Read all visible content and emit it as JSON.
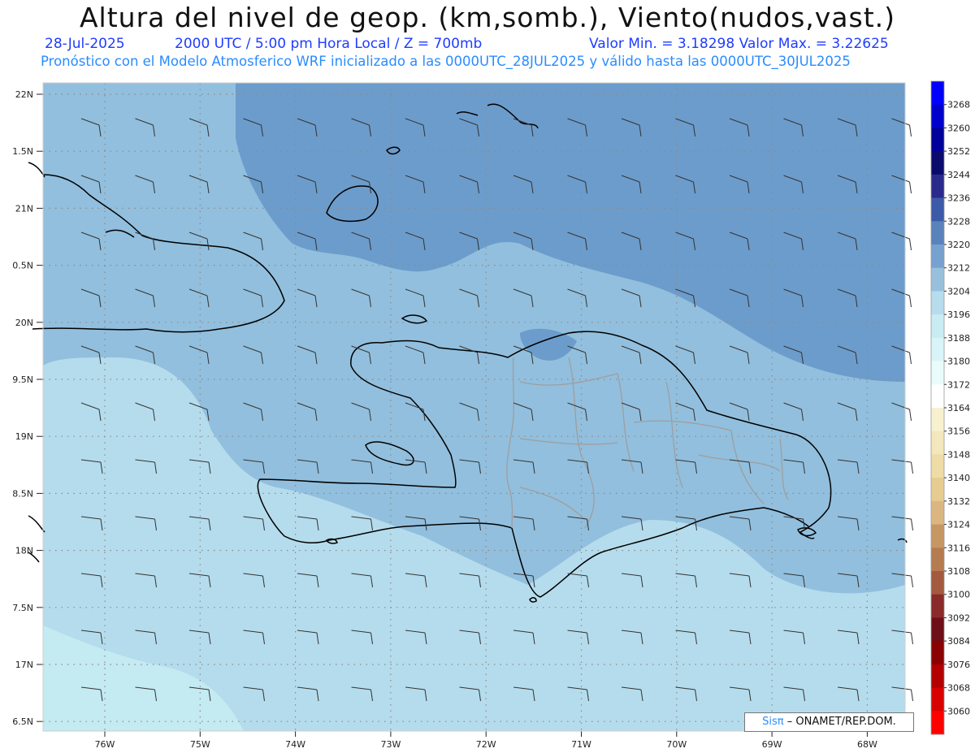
{
  "header": {
    "title": "Altura del nivel de geop. (km,somb.), Viento(nudos,vast.)",
    "date": "28-Jul-2025",
    "time_info": "2000 UTC / 5:00 pm Hora Local / Z = 700mb",
    "minmax": "Valor Min. = 3.18298   Valor Max. = 3.22625",
    "forecast_info": "Pronóstico con el Modelo Atmosferico WRF inicializado a las 0000UTC_28JUL2025 y válido hasta las  0000UTC_30JUL2025"
  },
  "axes": {
    "lat_labels": [
      "22N",
      "1.5N",
      "21N",
      "0.5N",
      "20N",
      "9.5N",
      "19N",
      "8.5N",
      "18N",
      "7.5N",
      "17N",
      "6.5N"
    ],
    "lon_labels": [
      "76W",
      "75W",
      "74W",
      "73W",
      "72W",
      "71W",
      "70W",
      "69W",
      "68W"
    ]
  },
  "colorbar": {
    "labels": [
      "3268",
      "3260",
      "3252",
      "3244",
      "3236",
      "3228",
      "3220",
      "3212",
      "3204",
      "3196",
      "3188",
      "3180",
      "3172",
      "3164",
      "3156",
      "3148",
      "3140",
      "3132",
      "3124",
      "3116",
      "3108",
      "3100",
      "3092",
      "3084",
      "3076",
      "3068",
      "3060"
    ],
    "colors": [
      "#0000ff",
      "#0000cc",
      "#00009a",
      "#0b0b6e",
      "#2a2a8c",
      "#3c5aa8",
      "#5a82bb",
      "#77a2cf",
      "#98c0dd",
      "#b7dcec",
      "#c9ecf3",
      "#d9f4f8",
      "#e8fcfc",
      "#ffffff",
      "#f8f1cf",
      "#f3e7bb",
      "#eedba6",
      "#e6cc90",
      "#dcb681",
      "#c79763",
      "#b47c50",
      "#a35a3e",
      "#8a2a2a",
      "#6e0e16",
      "#8b0000",
      "#b30000",
      "#d80000",
      "#ff0000"
    ]
  },
  "field_colors": {
    "high": "#6c9ccb",
    "mid": "#92bfdd",
    "low": "#b5dcec",
    "lowest": "#c4eaf2"
  },
  "credit": {
    "sis": "Sisπ",
    "text": "– ONAMET/REP.DOM."
  }
}
